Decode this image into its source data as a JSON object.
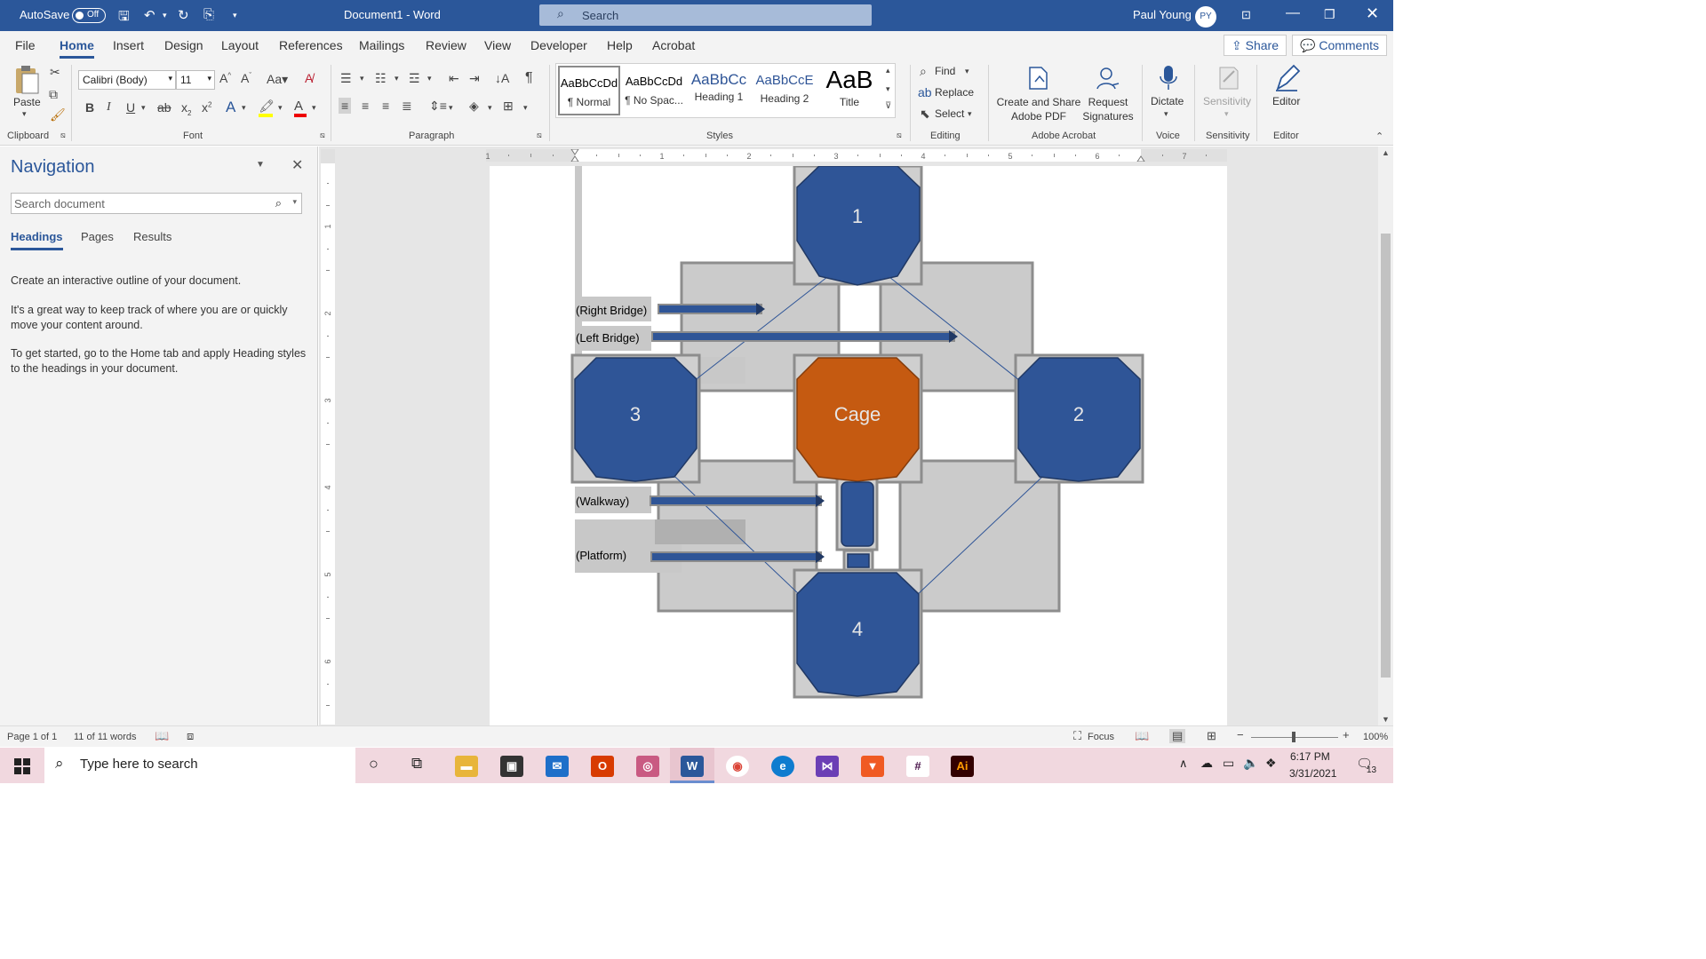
{
  "titlebar": {
    "autosave_label": "AutoSave",
    "autosave_state": "Off",
    "doc_title": "Document1  -  Word",
    "search_placeholder": "Search",
    "user_name": "Paul Young",
    "user_initials": "PY"
  },
  "tabs": [
    "File",
    "Home",
    "Insert",
    "Design",
    "Layout",
    "References",
    "Mailings",
    "Review",
    "View",
    "Developer",
    "Help",
    "Acrobat"
  ],
  "active_tab": "Home",
  "share_label": "Share",
  "comments_label": "Comments",
  "ribbon": {
    "clipboard": {
      "paste": "Paste",
      "group": "Clipboard"
    },
    "font": {
      "name": "Calibri (Body)",
      "size": "11",
      "group": "Font"
    },
    "paragraph": {
      "group": "Paragraph"
    },
    "styles": {
      "group": "Styles",
      "items": [
        {
          "sample": "AaBbCcDd",
          "name": "¶ Normal"
        },
        {
          "sample": "AaBbCcDd",
          "name": "¶ No Spac..."
        },
        {
          "sample": "AaBbCc",
          "name": "Heading 1"
        },
        {
          "sample": "AaBbCcE",
          "name": "Heading 2"
        },
        {
          "sample": "AaB",
          "name": "Title"
        }
      ]
    },
    "editing": {
      "find": "Find",
      "replace": "Replace",
      "select": "Select",
      "group": "Editing"
    },
    "acrobat": {
      "create_share": "Create and Share Adobe PDF",
      "request_signatures": "Request Signatures",
      "group": "Adobe Acrobat"
    },
    "voice": {
      "dictate": "Dictate",
      "group": "Voice"
    },
    "sensitivity": {
      "label": "Sensitivity",
      "group": "Sensitivity"
    },
    "editor": {
      "label": "Editor",
      "group": "Editor"
    }
  },
  "navigation": {
    "title": "Navigation",
    "search_placeholder": "Search document",
    "tabs": [
      "Headings",
      "Pages",
      "Results"
    ],
    "para1": "Create an interactive outline of your document.",
    "para2": "It's a great way to keep track of where you are or quickly move your content around.",
    "para3": "To get started, go to the Home tab and apply Heading styles to the headings in your document."
  },
  "diagram": {
    "nodes": {
      "n1": "1",
      "n2": "2",
      "n3": "3",
      "n4": "4",
      "cage": "Cage"
    },
    "labels": {
      "right_bridge": "(Right Bridge)",
      "left_bridge": "(Left Bridge)",
      "walkway": "(Walkway)",
      "platform": "(Platform)"
    },
    "colors": {
      "blue": "#2f5597",
      "orange": "#c55a11"
    }
  },
  "ruler": {
    "marks": [
      "1",
      "1",
      "2",
      "3",
      "4",
      "5",
      "6",
      "7"
    ],
    "vmarks": [
      "1",
      "2",
      "3",
      "4",
      "5",
      "6"
    ]
  },
  "statusbar": {
    "page": "Page 1 of 1",
    "words": "11 of 11 words",
    "focus": "Focus",
    "zoom": "100%"
  },
  "taskbar": {
    "search_placeholder": "Type here to search",
    "time": "6:17 PM",
    "date": "3/31/2021",
    "notif": "13"
  }
}
